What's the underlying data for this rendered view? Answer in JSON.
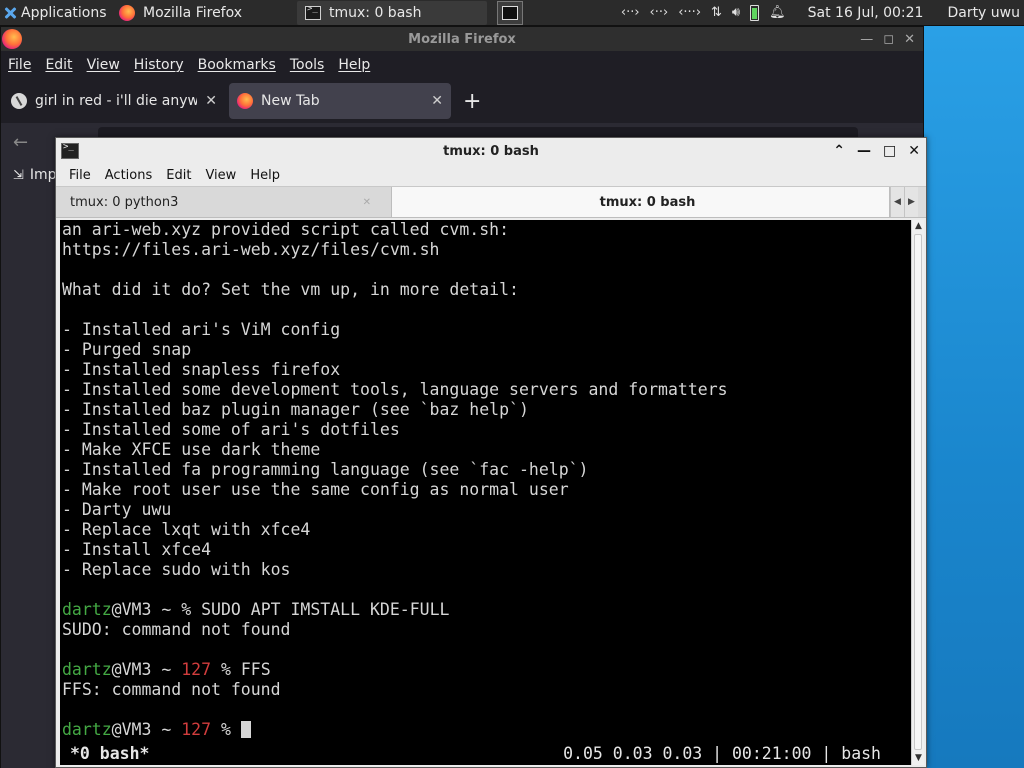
{
  "panel": {
    "app_menu_label": "Applications",
    "tasks": [
      {
        "label": "Mozilla Firefox"
      },
      {
        "label": "tmux: 0 bash"
      }
    ],
    "tray": {
      "icons": [
        "network-icon",
        "network-icon",
        "network-icon",
        "transfer-icon",
        "volume-icon",
        "battery-icon",
        "bell-icon"
      ],
      "clock": "Sat 16 Jul, 00:21",
      "user": "Darty uwu"
    }
  },
  "firefox": {
    "title": "Mozilla Firefox",
    "menu": [
      "File",
      "Edit",
      "View",
      "History",
      "Bookmarks",
      "Tools",
      "Help"
    ],
    "tabs": [
      {
        "label": "girl in red - i'll die anyway"
      },
      {
        "label": "New Tab"
      }
    ],
    "bookmarks_label": "Imp"
  },
  "terminal": {
    "title": "tmux: 0 bash",
    "menu": [
      "File",
      "Actions",
      "Edit",
      "View",
      "Help"
    ],
    "tabs": [
      {
        "label": "tmux: 0 python3"
      },
      {
        "label": "tmux: 0 bash"
      }
    ],
    "lines": [
      "an ari-web.xyz provided script called cvm.sh:",
      "https://files.ari-web.xyz/files/cvm.sh",
      "",
      "What did it do? Set the vm up, in more detail:",
      "",
      "- Installed ari's ViM config",
      "- Purged snap",
      "- Installed snapless firefox",
      "- Installed some development tools, language servers and formatters",
      "- Installed baz plugin manager (see `baz help`)",
      "- Installed some of ari's dotfiles",
      "- Make XFCE use dark theme",
      "- Installed fa programming language (see `fac -help`)",
      "- Make root user use the same config as normal user",
      "- Darty uwu",
      "- Replace lxqt with xfce4",
      "- Install xfce4",
      "- Replace sudo with kos",
      ""
    ],
    "prompts": [
      {
        "user": "dartz",
        "host": "@VM3 ~ ",
        "code": "",
        "sym": "% ",
        "cmd": "SUDO APT IMSTALL KDE-FULL",
        "output": "SUDO: command not found"
      },
      {
        "user": "dartz",
        "host": "@VM3 ~ ",
        "code": "127 ",
        "sym": "% ",
        "cmd": "FFS",
        "output": "FFS: command not found"
      },
      {
        "user": "dartz",
        "host": "@VM3 ~ ",
        "code": "127 ",
        "sym": "% ",
        "cmd": "",
        "output": ""
      }
    ],
    "status_left": "*0 bash*",
    "status_right": "0.05 0.03 0.03 | 00:21:00 | bash"
  },
  "colors": {
    "prompt_user": "#44a944",
    "exit_code": "#d23d3d",
    "desktop": "#1b8fd6"
  }
}
